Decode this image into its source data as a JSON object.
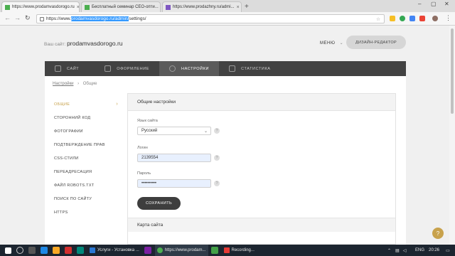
{
  "browser": {
    "tabs": [
      {
        "title": "https://www.prodamvasdorogo.ru",
        "active": true,
        "favicon_color": "#4caf50"
      },
      {
        "title": "Бесплатный семинар СЕО-опти...",
        "active": false,
        "favicon_color": "#4caf50"
      },
      {
        "title": "https://www.prodazhny.ru/admi...",
        "active": false,
        "favicon_color": "#7e57c2"
      }
    ],
    "new_tab_glyph": "+",
    "url_prefix": "https://www.",
    "url_selected": "prodamvasdorogo.ru/admin/",
    "url_suffix": "settings/"
  },
  "header": {
    "site_label": "Ваш сайт:",
    "site_name": "prodamvasdorogo.ru",
    "menu_label": "МЕНЮ",
    "design_editor_label": "ДИЗАЙН-РЕДАКТОР"
  },
  "main_nav": [
    {
      "label": "САЙТ",
      "icon": "site-icon",
      "active": false
    },
    {
      "label": "ОФОРМЛЕНИЕ",
      "icon": "brush-icon",
      "active": false
    },
    {
      "label": "НАСТРОЙКИ",
      "icon": "gear-icon",
      "active": true
    },
    {
      "label": "СТАТИСТИКА",
      "icon": "chart-icon",
      "active": false
    }
  ],
  "breadcrumb": {
    "parent": "Настройки",
    "separator": "›",
    "current": "Общие"
  },
  "side_menu": [
    {
      "label": "ОБЩИЕ",
      "active": true
    },
    {
      "label": "СТОРОННИЙ КОД",
      "active": false
    },
    {
      "label": "ФОТОГРАФИИ",
      "active": false
    },
    {
      "label": "ПОДТВЕРЖДЕНИЕ ПРАВ",
      "active": false
    },
    {
      "label": "CSS-СТИЛИ",
      "active": false
    },
    {
      "label": "ПЕРЕАДРЕСАЦИЯ",
      "active": false
    },
    {
      "label": "ФАЙЛ ROBOTS.TXT",
      "active": false
    },
    {
      "label": "ПОИСК ПО САЙТУ",
      "active": false
    },
    {
      "label": "HTTPS",
      "active": false
    }
  ],
  "settings": {
    "title": "Общие настройки",
    "language_label": "Язык сайта",
    "language_value": "Русский",
    "login_label": "Логин",
    "login_value": "2139554",
    "password_label": "Пароль",
    "password_value": "••••••••••",
    "help_glyph": "?",
    "save_label": "СОХРАНИТЬ",
    "sitemap_title": "Карта сайта"
  },
  "taskbar": {
    "items": [
      {
        "label": "Услуги - Установка ...",
        "color": "#2b78d4"
      },
      {
        "label": "https://www.prodam...",
        "color": "#4caf50"
      },
      {
        "label": "Recording...",
        "color": "#e53935"
      }
    ],
    "language": "ENG",
    "time": "20:26"
  },
  "colors": {
    "accent": "#c7a14a",
    "nav_bg": "#424242",
    "taskbar_bg": "#1c2530"
  }
}
